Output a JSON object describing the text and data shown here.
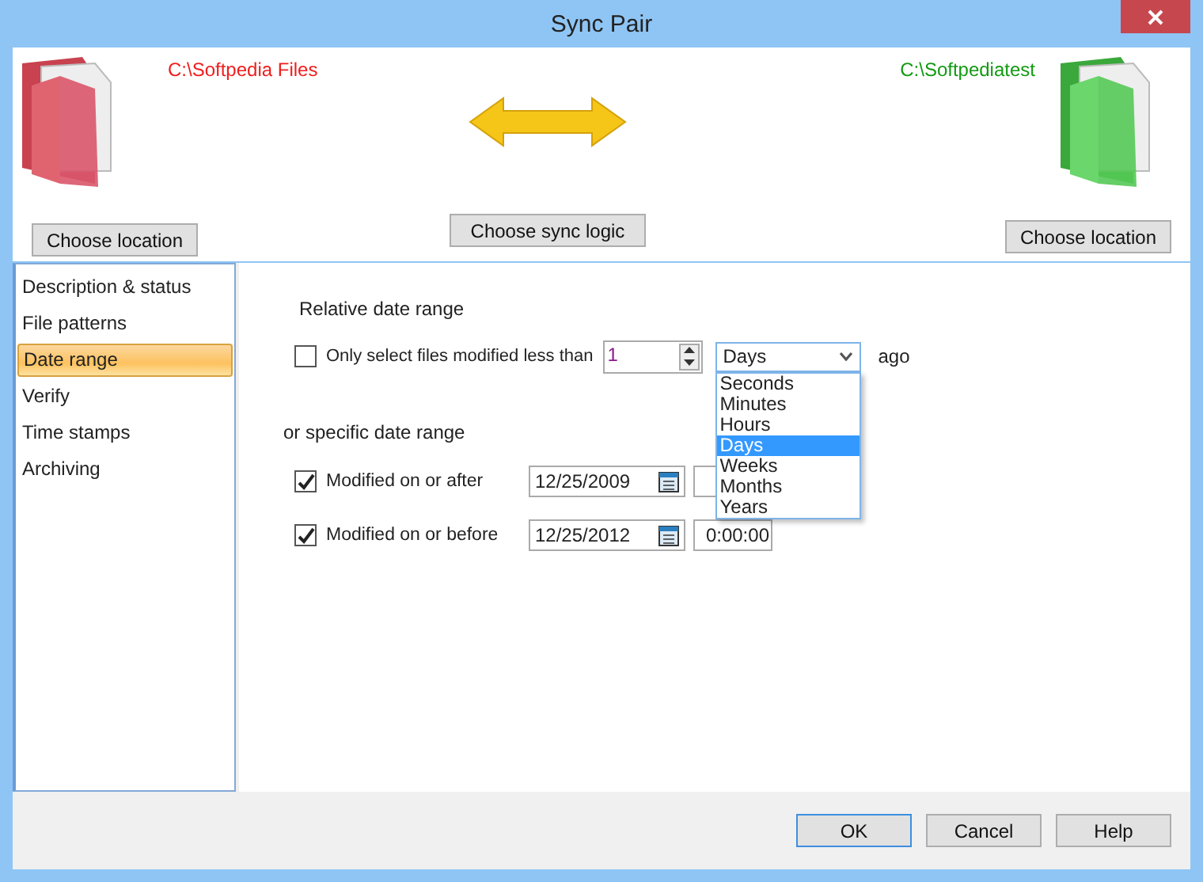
{
  "window": {
    "title": "Sync Pair"
  },
  "left": {
    "path": "C:\\Softpedia Files",
    "button": "Choose location"
  },
  "center": {
    "button": "Choose sync logic"
  },
  "right": {
    "path": "C:\\Softpediatest",
    "button": "Choose location"
  },
  "sidebar": {
    "items": [
      {
        "label": "Description & status",
        "selected": false
      },
      {
        "label": "File patterns",
        "selected": false
      },
      {
        "label": "Date range",
        "selected": true
      },
      {
        "label": "Verify",
        "selected": false
      },
      {
        "label": "Time stamps",
        "selected": false
      },
      {
        "label": "Archiving",
        "selected": false
      }
    ]
  },
  "relative": {
    "heading": "Relative date range",
    "checked": false,
    "label": "Only select files modified less than",
    "amount": "1",
    "unit": "Days",
    "suffix": "ago",
    "unit_options": [
      {
        "label": "Seconds",
        "selected": false
      },
      {
        "label": "Minutes",
        "selected": false
      },
      {
        "label": "Hours",
        "selected": false
      },
      {
        "label": "Days",
        "selected": true
      },
      {
        "label": "Weeks",
        "selected": false
      },
      {
        "label": "Months",
        "selected": false
      },
      {
        "label": "Years",
        "selected": false
      }
    ]
  },
  "specific": {
    "heading": "or specific date range",
    "rows": [
      {
        "label": "Modified on or after",
        "checked": true,
        "date": "12/25/2009"
      },
      {
        "label": "Modified on or before",
        "checked": true,
        "date": "12/25/2012",
        "time": "0:00:00"
      }
    ]
  },
  "buttons": [
    "OK",
    "Cancel",
    "Help"
  ]
}
